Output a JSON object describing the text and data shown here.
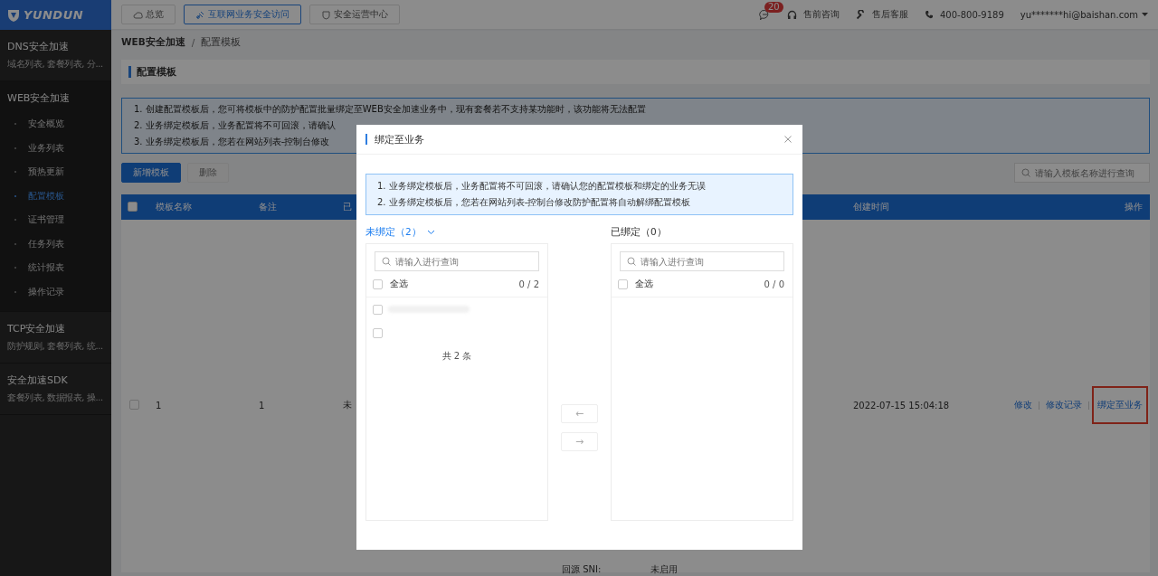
{
  "logo": {
    "text": "YUNDUN"
  },
  "top_nav": {
    "tabs": [
      {
        "label": "总览",
        "selected": false
      },
      {
        "label": "互联网业务安全访问",
        "selected": true
      },
      {
        "label": "安全运营中心",
        "selected": false
      }
    ]
  },
  "header_actions": {
    "messages_badge": "20",
    "presales": "售前咨询",
    "aftersales": "售后客服",
    "phone": "400-800-9189",
    "user": "yu*******hi@baishan.com"
  },
  "sidebar": {
    "groups": [
      {
        "title": "DNS安全加速",
        "subtitle": "域名列表, 套餐列表, 分...",
        "expanded": false
      },
      {
        "title": "WEB安全加速",
        "expanded": true,
        "children": [
          {
            "label": "安全概览",
            "selected": false
          },
          {
            "label": "业务列表",
            "selected": false
          },
          {
            "label": "预热更新",
            "selected": false
          },
          {
            "label": "配置模板",
            "selected": true
          },
          {
            "label": "证书管理",
            "selected": false
          },
          {
            "label": "任务列表",
            "selected": false
          },
          {
            "label": "统计报表",
            "selected": false
          },
          {
            "label": "操作记录",
            "selected": false
          }
        ]
      },
      {
        "title": "TCP安全加速",
        "subtitle": "防护规则, 套餐列表, 统...",
        "expanded": false
      },
      {
        "title": "安全加速SDK",
        "subtitle": "套餐列表, 数据报表, 操...",
        "expanded": false
      }
    ]
  },
  "breadcrumb": [
    "WEB安全加速",
    "配置模板"
  ],
  "breadcrumb_separator": "/",
  "page_title": "配置模板",
  "notices": [
    "1. 创建配置模板后，您可将模板中的防护配置批量绑定至WEB安全加速业务中，现有套餐若不支持某功能时，该功能将无法配置",
    "2. 业务绑定模板后，业务配置将不可回滚，请确认",
    "3. 业务绑定模板后，您若在网站列表-控制台修改"
  ],
  "toolbar": {
    "buttons": [
      {
        "label": "新增模板",
        "disabled": false
      },
      {
        "label": "删除",
        "disabled": true
      }
    ],
    "search": {
      "placeholder": "请输入模板名称进行查询"
    }
  },
  "table": {
    "header_checked": false,
    "columns": [
      "模板名称",
      "备注",
      "已",
      "创建时间",
      "操作"
    ],
    "rows": [
      {
        "checked": false,
        "cells": [
          "1",
          "1",
          "未",
          "2022-07-15 15:04:18"
        ],
        "actions": [
          {
            "label": "修改",
            "highlighted": false
          },
          {
            "label": "修改记录",
            "highlighted": false
          },
          {
            "label": "绑定至业务",
            "highlighted": true
          }
        ],
        "details": [
          {
            "label": "回源 SNI:",
            "value": "未启用"
          }
        ]
      }
    ]
  },
  "dialog": {
    "title": "绑定至业务",
    "notices": [
      "1. 业务绑定模板后，业务配置将不可回滚，请确认您的配置模板和绑定的业务无误",
      "2. 业务绑定模板后，您若在网站列表-控制台修改防护配置将自动解绑配置模板"
    ],
    "panels": [
      {
        "title": "未绑定（2）",
        "highlighted": true,
        "dropdown": true,
        "search_placeholder": "请输入进行查询",
        "select_all": "全选",
        "select_all_checked": false,
        "count": "0 / 2",
        "items": [
          {
            "checked": false,
            "redacted_label": true
          },
          {
            "checked": false,
            "redacted_label": false
          }
        ],
        "footer": "共 2 条"
      },
      {
        "title": "已绑定（0）",
        "highlighted": false,
        "dropdown": false,
        "search_placeholder": "请输入进行查询",
        "select_all": "全选",
        "select_all_checked": false,
        "count": "0 / 0"
      }
    ],
    "move_buttons": [
      {
        "label": "←",
        "disabled": true
      },
      {
        "label": "→",
        "disabled": true
      }
    ]
  }
}
